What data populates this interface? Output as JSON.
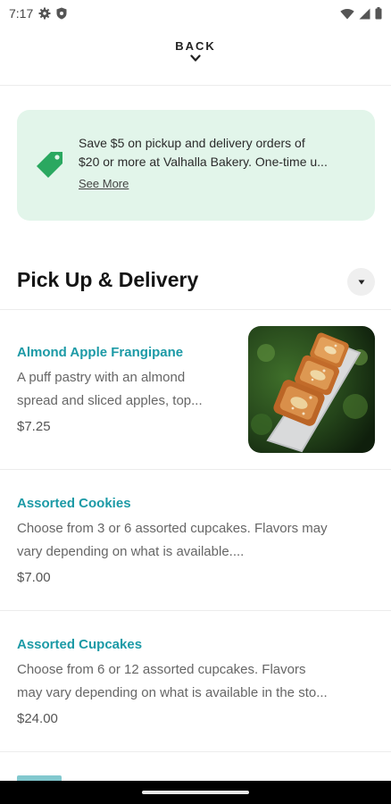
{
  "status_bar": {
    "time": "7:17",
    "left_icons": [
      "gear-icon",
      "shield-icon"
    ],
    "right_icons": [
      "wifi-icon",
      "signal-icon",
      "battery-icon"
    ]
  },
  "header": {
    "back_label": "BACK"
  },
  "promo": {
    "line1": "Save $5 on pickup and delivery orders of",
    "line2": "$20 or more at Valhalla Bakery. One-time u...",
    "see_more": "See More",
    "icon": "price-tag-icon",
    "accent_color": "#2aa860",
    "background_color": "#e2f5ea"
  },
  "section": {
    "title": "Pick Up & Delivery"
  },
  "items": [
    {
      "name": "Almond Apple Frangipane",
      "desc_line1": "A puff pastry with an almond",
      "desc_line2": "spread and sliced apples, top...",
      "price": "$7.25"
    },
    {
      "name": "Assorted Cookies",
      "desc_line1": "Choose from 3 or 6 assorted cupcakes. Flavors may",
      "desc_line2": "vary depending on what is available....",
      "price": "$7.00"
    },
    {
      "name": "Assorted Cupcakes",
      "desc_line1": "Choose from 6 or 12 assorted cupcakes. Flavors",
      "desc_line2": "may vary depending on what is available in the sto...",
      "price": "$24.00"
    }
  ],
  "colors": {
    "item_name": "#1c9aa6",
    "divider": "#ececec"
  }
}
